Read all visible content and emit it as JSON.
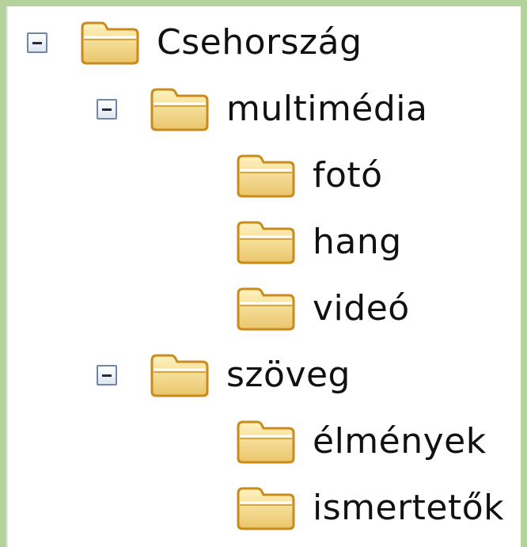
{
  "tree": {
    "root": {
      "label": "Csehország",
      "icon": "folder-open-icon",
      "children": {
        "multimedia": {
          "label": "multimédia",
          "icon": "folder-open-icon",
          "children": [
            "fotó",
            "hang",
            "videó"
          ]
        },
        "szoveg": {
          "label": "szöveg",
          "icon": "folder-open-icon",
          "children": [
            "élmények",
            "ismertetők"
          ]
        }
      }
    },
    "items": {
      "foto": "fotó",
      "hang": "hang",
      "video": "videó",
      "elmenyek": "élmények",
      "ismertetok": "ismertetők"
    }
  },
  "colors": {
    "background": "#b4d29a",
    "panel": "#ffffff",
    "folder_fill": "#f6dc8a",
    "folder_stroke": "#c98a1e",
    "toggle_border": "#6f86a8"
  }
}
